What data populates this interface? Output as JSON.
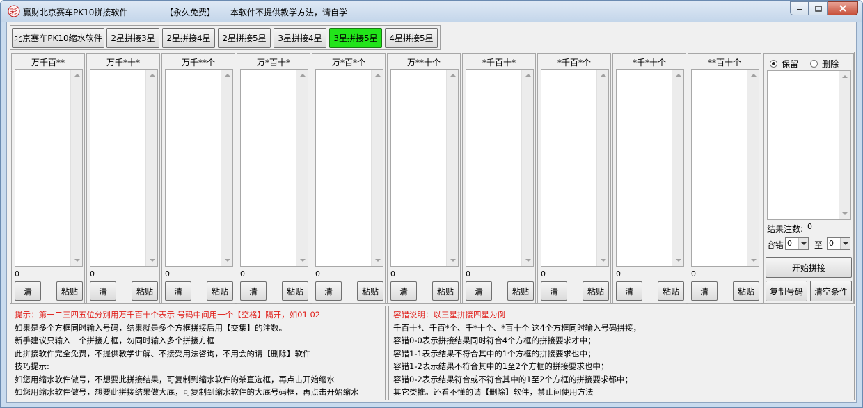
{
  "window": {
    "title": "赢财北京赛车PK10拼接软件",
    "free_label": "【永久免费】",
    "notice": "本软件不提供教学方法，请自学"
  },
  "tabs": [
    {
      "label": "北京塞车PK10缩水软件",
      "active": false
    },
    {
      "label": "2星拼接3星",
      "active": false
    },
    {
      "label": "2星拼接4星",
      "active": false
    },
    {
      "label": "2星拼接5星",
      "active": false
    },
    {
      "label": "3星拼接4星",
      "active": false
    },
    {
      "label": "3星拼接5星",
      "active": true
    },
    {
      "label": "4星拼接5星",
      "active": false
    }
  ],
  "columns": [
    {
      "title": "万千百**",
      "count": "0",
      "clear": "清",
      "paste": "粘贴"
    },
    {
      "title": "万千*十*",
      "count": "0",
      "clear": "清",
      "paste": "粘贴"
    },
    {
      "title": "万千**个",
      "count": "0",
      "clear": "清",
      "paste": "粘贴"
    },
    {
      "title": "万*百十*",
      "count": "0",
      "clear": "清",
      "paste": "粘贴"
    },
    {
      "title": "万*百*个",
      "count": "0",
      "clear": "清",
      "paste": "粘贴"
    },
    {
      "title": "万**十个",
      "count": "0",
      "clear": "清",
      "paste": "粘贴"
    },
    {
      "title": "*千百十*",
      "count": "0",
      "clear": "清",
      "paste": "粘贴"
    },
    {
      "title": "*千百*个",
      "count": "0",
      "clear": "清",
      "paste": "粘贴"
    },
    {
      "title": "*千*十个",
      "count": "0",
      "clear": "清",
      "paste": "粘贴"
    },
    {
      "title": "**百十个",
      "count": "0",
      "clear": "清",
      "paste": "粘贴"
    }
  ],
  "result": {
    "keep_label": "保留",
    "delete_label": "删除",
    "selected": "keep",
    "count_label": "结果注数:",
    "count_value": "0",
    "tolerance_label": "容错",
    "tolerance_from": "0",
    "to_label": "至",
    "tolerance_to": "0",
    "start_button": "开始拼接",
    "copy_button": "复制号码",
    "clear_button": "清空条件"
  },
  "notes_left": [
    {
      "text": "提示：第一二三四五位分别用万千百十个表示   号码中间用一个【空格】隔开，如01 02",
      "red": true
    },
    {
      "text": "如果是多个方框同时输入号码，结果就是多个方框拼接后用【交集】的注数。",
      "red": false
    },
    {
      "text": "新手建议只输入一个拼接方框，勿同时输入多个拼接方框",
      "red": false
    },
    {
      "text": "此拼接软件完全免费，不提供教学讲解、不接受用法咨询，不用会的请【删除】软件",
      "red": false
    },
    {
      "text": "技巧提示:",
      "red": false
    },
    {
      "text": "如您用缩水软件做号，不想要此拼接结果，可复制到缩水软件的杀直选框，再点击开始缩水",
      "red": false
    },
    {
      "text": "如您用缩水软件做号，想要此拼接结果做大底，可复制到缩水软件的大底号码框，再点击开始缩水",
      "red": false
    }
  ],
  "notes_right": [
    {
      "text": "容错说明：以三星拼接四星为例",
      "red": true
    },
    {
      "text": "千百十*、千百*个、千*十个、*百十个 这4个方框同时输入号码拼接，",
      "red": false
    },
    {
      "text": "容错0-0表示拼接结果同时符合4个方框的拼接要求才中；",
      "red": false
    },
    {
      "text": "容错1-1表示结果不符合其中的1个方框的拼接要求也中；",
      "red": false
    },
    {
      "text": "容错1-2表示结果不符合其中的1至2个方框的拼接要求也中；",
      "red": false
    },
    {
      "text": "容错0-2表示结果符合或不符合其中的1至2个方框的拼接要求都中；",
      "red": false
    },
    {
      "text": "其它类推。还看不懂的请【删除】软件，禁止问使用方法",
      "red": false
    }
  ],
  "colors": {
    "active_tab": "#22e41a",
    "note_red": "#e0201b"
  }
}
